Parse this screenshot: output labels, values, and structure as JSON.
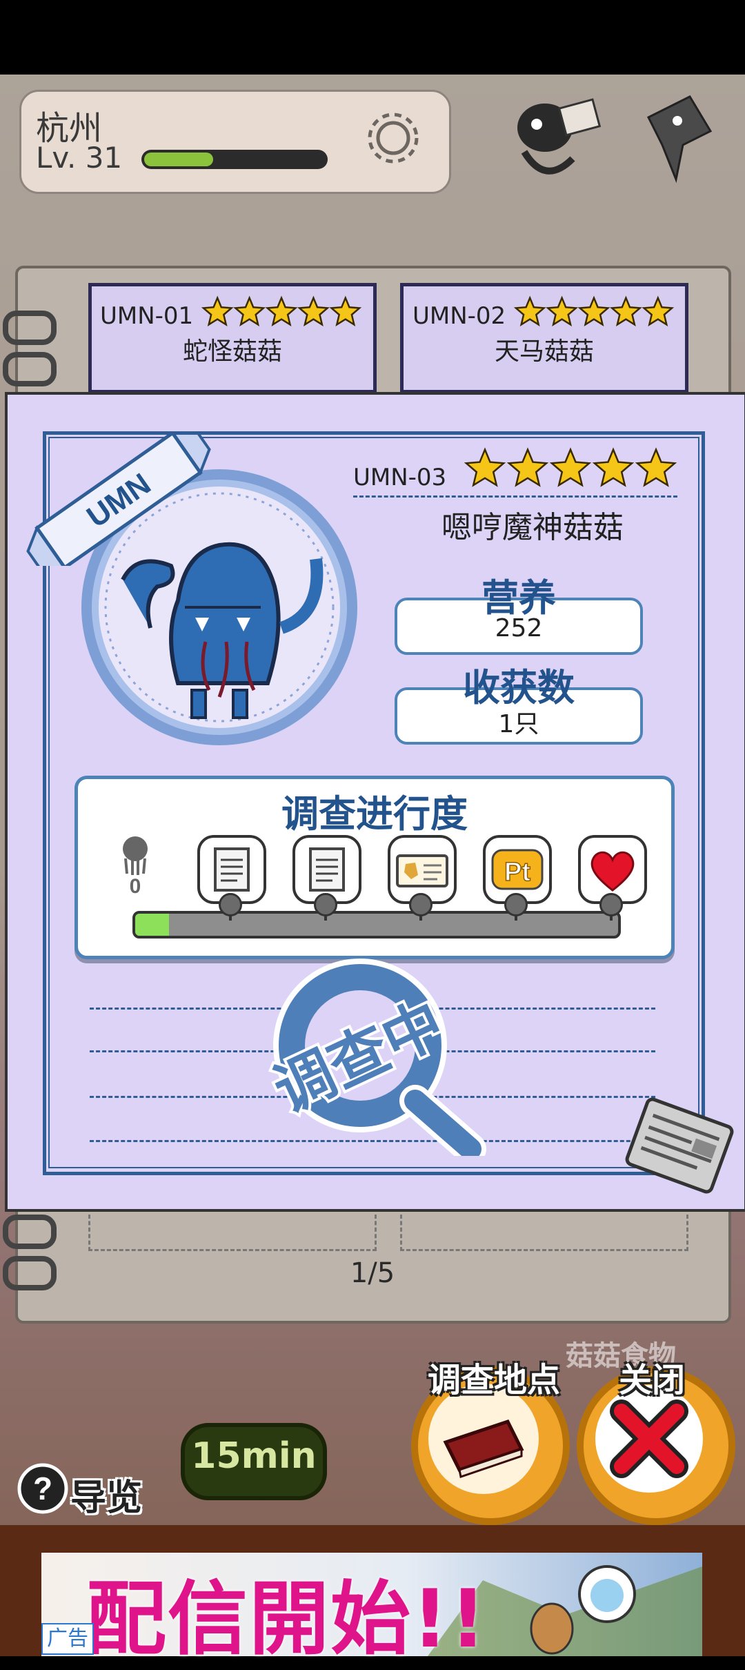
{
  "header": {
    "city": "杭州",
    "level": "Lv. 31",
    "xp_progress": 0.38
  },
  "book": {
    "cards": [
      {
        "id": "UMN-01",
        "name": "蛇怪菇菇",
        "stars": 5
      },
      {
        "id": "UMN-02",
        "name": "天马菇菇",
        "stars": 5
      }
    ],
    "pager": "1/5"
  },
  "modal": {
    "ribbon": "UMN",
    "id": "UMN-03",
    "stars": 5,
    "name": "嗯哼魔神菇菇",
    "stats": [
      {
        "label": "营养",
        "value": "252"
      },
      {
        "label": "收获数",
        "value": "1只"
      }
    ],
    "progress": {
      "title": "调查进行度",
      "count": "0",
      "fraction": 0.07,
      "milestones": [
        "document-icon",
        "document-icon",
        "id-card-icon",
        "pt-icon",
        "heart-icon"
      ],
      "pt_text": "Pt"
    },
    "stamp": "调查中"
  },
  "controls": {
    "guide": "导览",
    "timer": "15min",
    "survey_location": "调查地点",
    "close": "关闭",
    "background_label": "菇菇食物"
  },
  "ad": {
    "headline": "配信開始!!",
    "tag": "广告"
  },
  "colors": {
    "accent_blue": "#23538c",
    "modal_bg": "#ddd3f7",
    "progress_green": "#8de05a",
    "close_red": "#e3142a"
  }
}
